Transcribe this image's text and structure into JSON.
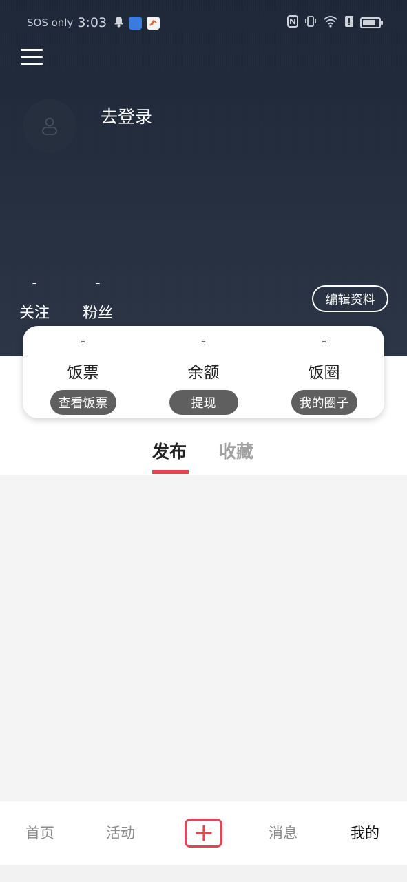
{
  "status_bar": {
    "carrier": "SOS only",
    "time": "3:03"
  },
  "profile": {
    "login_label": "去登录",
    "edit_label": "编辑资料"
  },
  "stats": {
    "follow": {
      "value": "-",
      "label": "关注"
    },
    "fans": {
      "value": "-",
      "label": "粉丝"
    }
  },
  "card": {
    "items": [
      {
        "value": "-",
        "label": "饭票",
        "button": "查看饭票"
      },
      {
        "value": "-",
        "label": "余额",
        "button": "提现"
      },
      {
        "value": "-",
        "label": "饭圈",
        "button": "我的圈子"
      }
    ]
  },
  "tabs": [
    {
      "label": "发布",
      "active": true
    },
    {
      "label": "收藏",
      "active": false
    }
  ],
  "bottom_nav": {
    "items": [
      {
        "label": "首页"
      },
      {
        "label": "活动"
      },
      {
        "label": "消息"
      },
      {
        "label": "我的"
      }
    ],
    "add_icon": "plus-box-icon"
  },
  "colors": {
    "accent": "#e34550",
    "hero_bg": "#222c3c",
    "pill_bg": "#5f5f5f"
  }
}
